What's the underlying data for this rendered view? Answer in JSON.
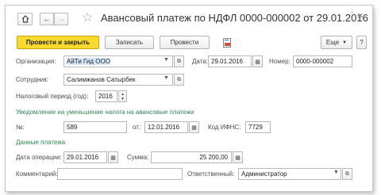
{
  "window": {
    "title": "Авансовый платеж по НДФЛ 0000-000002 от 29.01.2016",
    "more_icon": "more-icon",
    "close_icon": "close-icon"
  },
  "toolbar": {
    "post_and_close": "Провести и закрыть",
    "save": "Записать",
    "post": "Провести",
    "more": "Еще",
    "help": "?"
  },
  "form": {
    "organization_label": "Организация:",
    "organization_value": "АйТи Гид ООО",
    "date_label": "Дата:",
    "date_value": "29.01.2016",
    "number_label": "Номер:",
    "number_value": "0000-000002",
    "employee_label": "Сотрудник:",
    "employee_value": "Салимжанов Сатырбек",
    "tax_period_label": "Налоговый период (год):",
    "tax_period_value": "2016",
    "notice_section": "Уведомление на уменьшение налога на авансовые платежи",
    "notice_number_label": "№:",
    "notice_number_value": "589",
    "notice_date_label": "от:",
    "notice_date_value": "12.01.2016",
    "ifns_label": "Код ИФНС:",
    "ifns_value": "7729",
    "payment_section": "Данные платежа",
    "operation_date_label": "Дата операции:",
    "operation_date_value": "29.01.2016",
    "amount_label": "Сумма:",
    "amount_value": "25 200,00",
    "comment_label": "Комментарий:",
    "comment_value": "",
    "responsible_label": "Ответственный:",
    "responsible_value": "Администратор"
  },
  "colors": {
    "primary_button": "#f9d92c",
    "section_title": "#2e8b57",
    "highlight": "#d6e9fb"
  }
}
